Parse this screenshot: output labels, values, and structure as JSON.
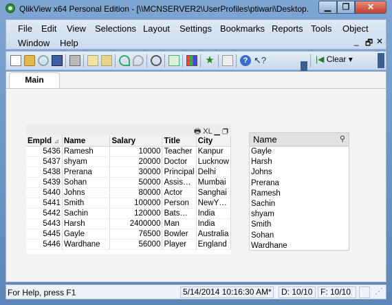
{
  "window": {
    "title": "QlikView x64 Personal Edition - [\\\\MCNSERVER2\\UserProfiles\\ptiwari\\Desktop...",
    "minimize_glyph": "▁",
    "maximize_glyph": "❐",
    "close_glyph": "✕"
  },
  "menu": {
    "items": [
      "File",
      "Edit",
      "View",
      "Selections",
      "Layout",
      "Settings",
      "Bookmarks",
      "Reports",
      "Tools",
      "Object",
      "Window",
      "Help"
    ],
    "mdi": {
      "minimize": "_",
      "restore": "🗗",
      "close": "✕"
    }
  },
  "toolbar": {
    "clear_label": "Clear",
    "clear_icon": "|◀",
    "dropdown": "▾",
    "icons": [
      "new-icon",
      "open-icon",
      "reload-icon",
      "save-icon",
      "print-icon",
      "edit-script-icon",
      "reload-data-icon",
      "undo-icon",
      "redo-icon",
      "search-icon",
      "select-icon",
      "chart-icon",
      "bookmark-star-icon",
      "edit-icon",
      "help-icon",
      "context-help-icon"
    ]
  },
  "tabs": [
    "Main"
  ],
  "straight_table": {
    "caption_icons": "🖶 XL ▁ ❐",
    "columns": [
      "EmpId",
      "Name",
      "Salary",
      "Title",
      "City"
    ],
    "sort_indicator": "⊿",
    "rows": [
      [
        "5436",
        "Ramesh",
        "10000",
        "Teacher",
        "Kanpur"
      ],
      [
        "5437",
        "shyam",
        "20000",
        "Doctor",
        "Lucknow"
      ],
      [
        "5438",
        "Prerana",
        "30000",
        "Principal",
        "Delhi"
      ],
      [
        "5439",
        "Sohan",
        "50000",
        "Assis…",
        "Mumbai"
      ],
      [
        "5440",
        "Johns",
        "80000",
        "Actor",
        "Sanghai"
      ],
      [
        "5441",
        "Smith",
        "100000",
        "Person",
        "NewY…"
      ],
      [
        "5442",
        "Sachin",
        "120000",
        "Bats…",
        "India"
      ],
      [
        "5443",
        "Harsh",
        "2400000",
        "Man",
        "India"
      ],
      [
        "5445",
        "Gayle",
        "76500",
        "Bowler",
        "Australia"
      ],
      [
        "5446",
        "Wardhane",
        "56000",
        "Player",
        "England"
      ]
    ]
  },
  "list_box": {
    "title": "Name",
    "search_glyph": "⚲",
    "items": [
      "Gayle",
      "Harsh",
      "Johns",
      "Prerana",
      "Ramesh",
      "Sachin",
      "shyam",
      "Smith",
      "Sohan",
      "Wardhane"
    ]
  },
  "status": {
    "help": "For Help, press F1",
    "timestamp": "5/14/2014 10:16:30 AM*",
    "d_count": "D: 10/10",
    "f_count": "F: 10/10"
  }
}
